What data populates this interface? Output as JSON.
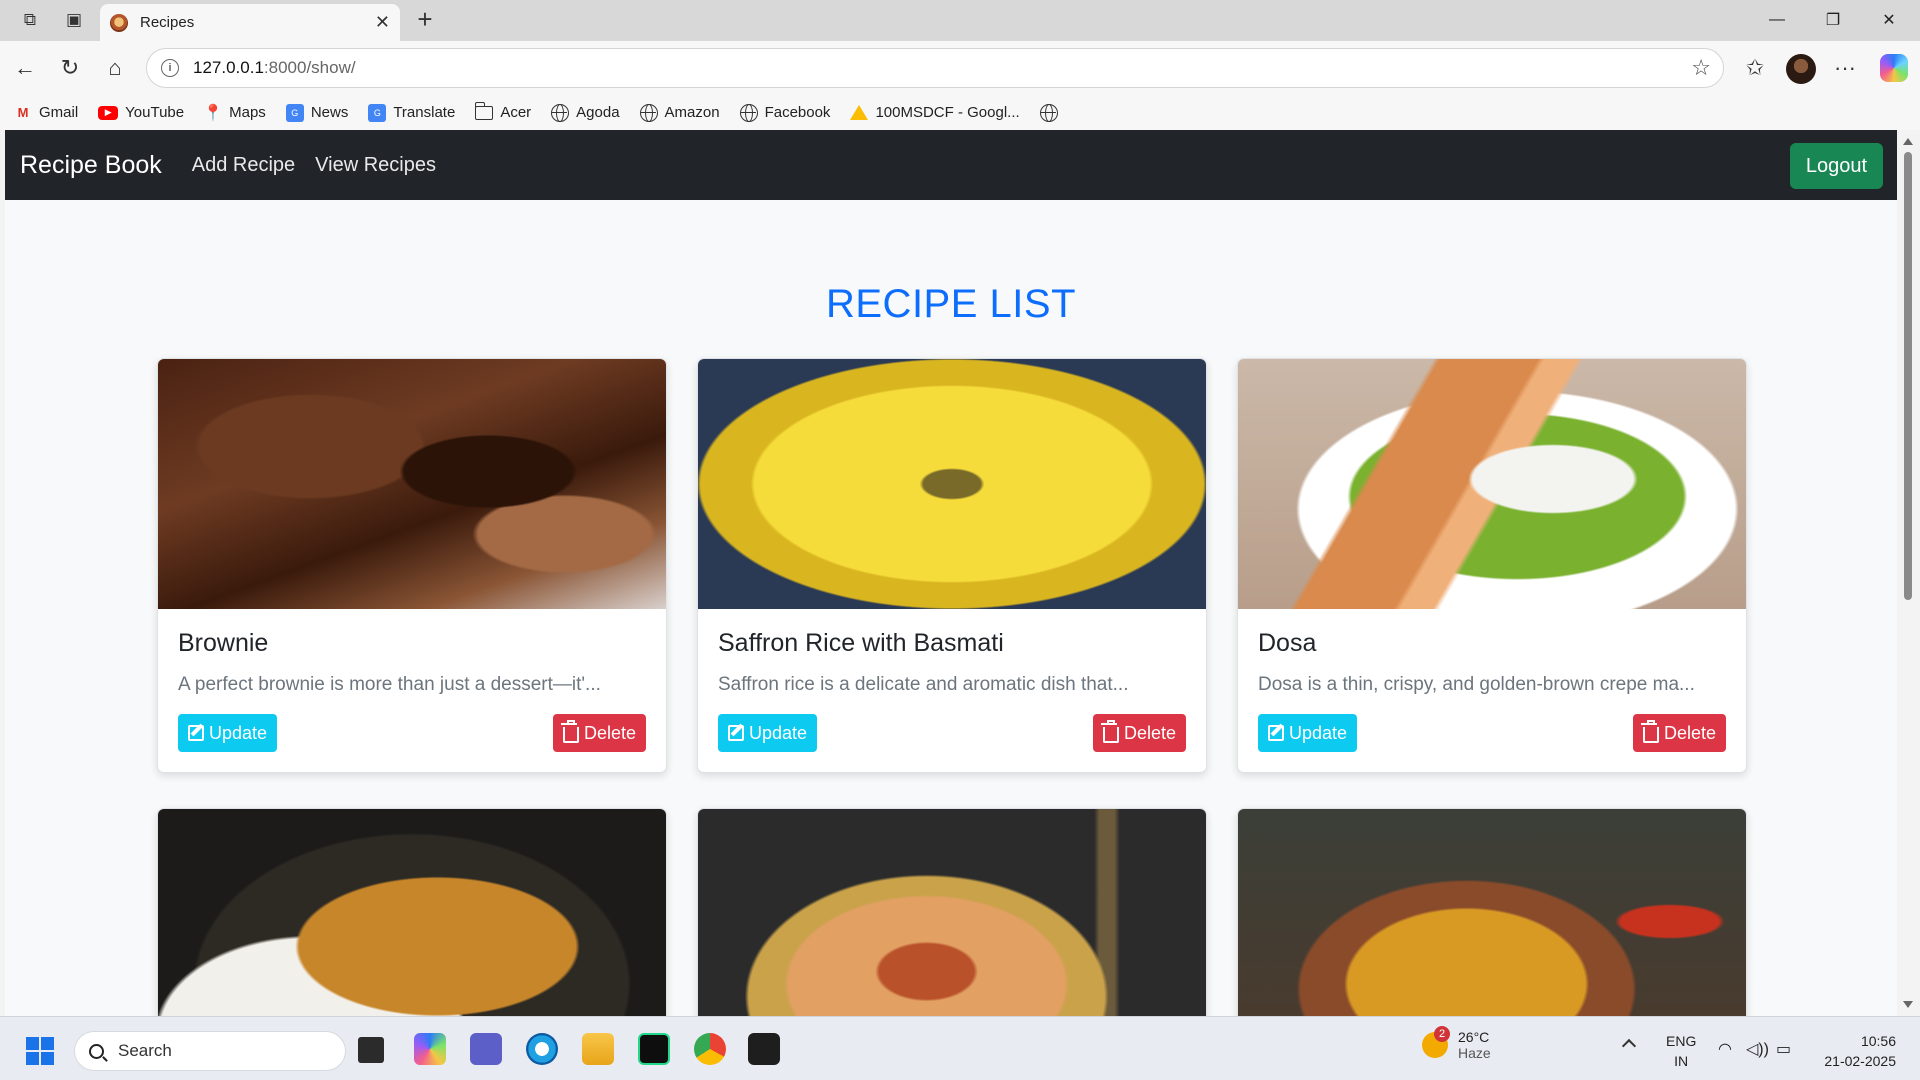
{
  "browser": {
    "tab_title": "Recipes",
    "url_host": "127.0.0.1",
    "url_path": ":8000/show/",
    "bookmarks": [
      {
        "label": "Gmail",
        "icon": "gmail-icon"
      },
      {
        "label": "YouTube",
        "icon": "youtube-icon"
      },
      {
        "label": "Maps",
        "icon": "maps-icon"
      },
      {
        "label": "News",
        "icon": "news-icon"
      },
      {
        "label": "Translate",
        "icon": "translate-icon"
      },
      {
        "label": "Acer",
        "icon": "folder-icon"
      },
      {
        "label": "Agoda",
        "icon": "globe-icon"
      },
      {
        "label": "Amazon",
        "icon": "globe-icon"
      },
      {
        "label": "Facebook",
        "icon": "globe-icon"
      },
      {
        "label": "100MSDCF - Googl...",
        "icon": "google-drive-icon"
      }
    ]
  },
  "app": {
    "brand": "Recipe Book",
    "nav": {
      "add": "Add Recipe",
      "view": "View Recipes"
    },
    "logout": "Logout",
    "heading": "RECIPE LIST",
    "update_label": "Update",
    "delete_label": "Delete",
    "recipes": [
      {
        "name": "Brownie",
        "desc": "A perfect brownie is more than just a dessert—it'...",
        "image": "brownie"
      },
      {
        "name": "Saffron Rice with Basmati",
        "desc": "Saffron rice is a delicate and aromatic dish that...",
        "image": "saffron-rice"
      },
      {
        "name": "Dosa",
        "desc": "Dosa is a thin, crispy, and golden-brown crepe ma...",
        "image": "dosa"
      },
      {
        "name": "",
        "desc": "",
        "image": "curry"
      },
      {
        "name": "",
        "desc": "",
        "image": "biryani"
      },
      {
        "name": "",
        "desc": "",
        "image": "dal"
      }
    ]
  },
  "taskbar": {
    "search": "Search",
    "weather_temp": "26°C",
    "weather_desc": "Haze",
    "weather_badge": "2",
    "lang_1": "ENG",
    "lang_2": "IN",
    "time": "10:56",
    "date": "21-02-2025"
  }
}
